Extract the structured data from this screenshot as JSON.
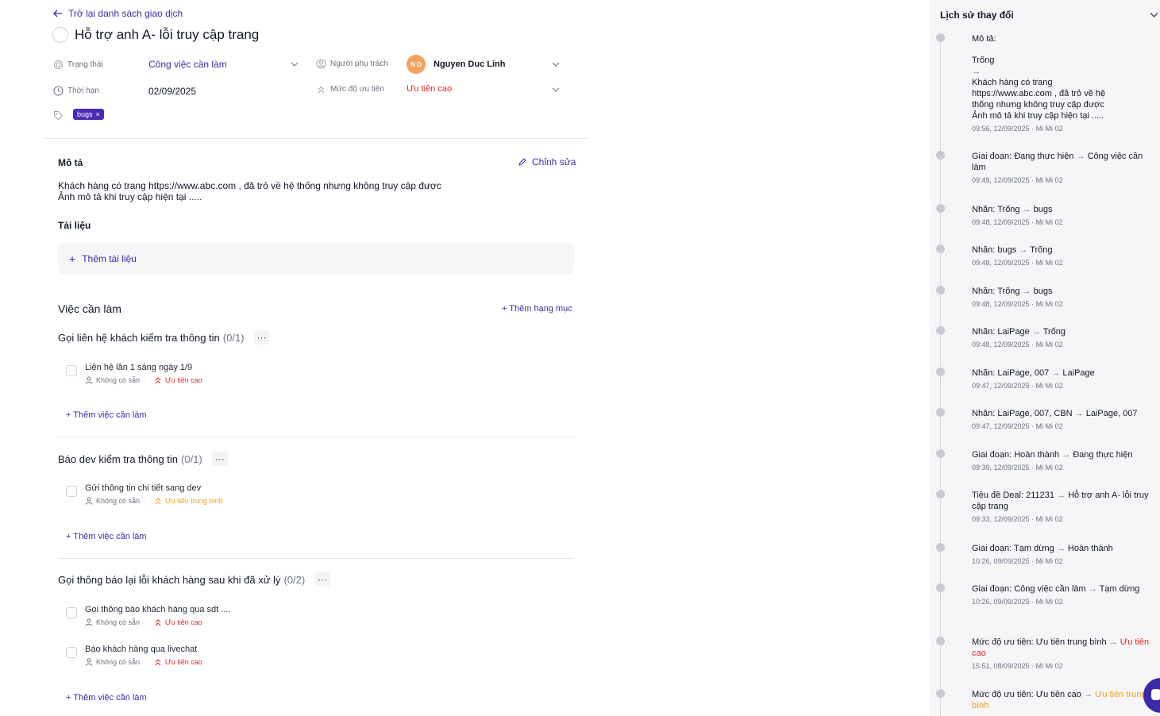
{
  "back": {
    "label": "Trở lại danh sách giao dịch"
  },
  "deal": {
    "title": "Hỗ trợ anh A- lỗi truy cập trang"
  },
  "fields": {
    "status_label": "Trạng thái",
    "status_value": "Công việc cần làm",
    "deadline_label": "Thời hạn",
    "deadline_value": "02/09/2025",
    "assignee_label": "Người phụ trách",
    "assignee_initials": "N D",
    "assignee_name": "Nguyen Duc Linh",
    "priority_label": "Mức độ ưu tiên",
    "priority_value": "Ưu tiên cao"
  },
  "tags": [
    {
      "label": "bugs"
    }
  ],
  "description": {
    "heading": "Mô tả",
    "edit_label": "Chỉnh sửa",
    "line1": "Khách hàng có trang https://www.abc.com , đã trỏ về hệ thống nhưng không truy cập được",
    "line2": "Ảnh mô tả khi truy cập hiện tại ....."
  },
  "documents": {
    "heading": "Tài liệu",
    "add_label": "Thêm tài liệu"
  },
  "todo": {
    "heading": "Việc cần làm",
    "add_category": "+ Thêm hạng mục",
    "add_task_label": "+ Thêm việc cần làm",
    "groups": [
      {
        "title": "Gọi liên hệ khách kiểm tra thông tin",
        "count": "(0/1)",
        "tasks": [
          {
            "name": "Liên hệ lần 1 sáng ngày 1/9",
            "assignee": "Không có sẵn",
            "priority": "Ưu tiên cao"
          }
        ]
      },
      {
        "title": "Báo dev kiểm tra thông tin",
        "count": "(0/1)",
        "tasks": [
          {
            "name": "Gửi thông tin chi tiết sang dev",
            "assignee": "Không có sẵn",
            "priority": "Ưu tiên trung bình"
          }
        ]
      },
      {
        "title": "Gọi thông báo lại lỗi khách hàng sau khi đã xử lý",
        "count": "(0/2)",
        "tasks": [
          {
            "name": "Gọi thông báo khách hàng qua sdt ....",
            "assignee": "Không có sẵn",
            "priority": "Ưu tiên cao"
          },
          {
            "name": "Báo khách hàng qua livechat",
            "assignee": "Không có sẵn",
            "priority": "Ưu tiên cao"
          }
        ]
      }
    ]
  },
  "history": {
    "heading": "Lịch sử thay đổi",
    "first": {
      "label": "Mô tả:",
      "from": "Trống",
      "arrow": "→",
      "to_line1": "Khách hàng có trang",
      "to_line2": "https://www.abc.com , đã trỏ về hệ",
      "to_line3": "thống nhưng không truy cập được",
      "to_line4": "Ảnh mô tả khi truy cập hiện tại .....",
      "time": "09:56, 12/09/2025 · Mi Mi 02"
    },
    "items": [
      {
        "label": "Giai đoạn:",
        "from": "Đang thực hiện",
        "to": "Công việc cần làm",
        "time": "09:49, 12/09/2025 · Mi Mi 02"
      },
      {
        "label": "Nhãn:",
        "from": "Trống",
        "to": "bugs",
        "time": "09:48, 12/09/2025 · Mi Mi 02"
      },
      {
        "label": "Nhãn:",
        "from": "bugs",
        "to": "Trống",
        "time": "09:48, 12/09/2025 · Mi Mi 02"
      },
      {
        "label": "Nhãn:",
        "from": "Trống",
        "to": "bugs",
        "time": "09:48, 12/09/2025 · Mi Mi 02"
      },
      {
        "label": "Nhãn:",
        "from": "LaiPage",
        "to": "Trống",
        "time": "09:48, 12/09/2025 · Mi Mi 02"
      },
      {
        "label": "Nhãn:",
        "from": "LaiPage, 007",
        "to": "LaiPage",
        "time": "09:47, 12/09/2025 · Mi Mi 02"
      },
      {
        "label": "Nhãn:",
        "from": "LaiPage, 007, CBN",
        "to": "LaiPage, 007",
        "time": "09:47, 12/09/2025 · Mi Mi 02"
      },
      {
        "label": "Giai đoạn:",
        "from": "Hoàn thành",
        "to": "Đang thực hiện",
        "time": "09:39, 12/09/2025 · Mi Mi 02"
      },
      {
        "label": "Tiêu đề Deal:",
        "from": "211231",
        "to": "Hỗ trợ anh A- lỗi truy cập trang",
        "time": "09:33, 12/09/2025 · Mi Mi 02"
      },
      {
        "label": "Giai đoạn:",
        "from": "Tạm dừng",
        "to": "Hoàn thành",
        "time": "10:26, 09/09/2025 · Mi Mi 02"
      },
      {
        "label": "Giai đoạn:",
        "from": "Công việc cần làm",
        "to": "Tạm dừng",
        "time": "10:26, 09/09/2025 · Mi Mi 02"
      },
      {
        "label": "Mức độ ưu tiên:",
        "from": "Ưu tiên trung bình",
        "to": "Ưu tiên cao",
        "to_color": "#dc2626",
        "time": "15:51, 08/09/2025 · Mi Mi 02"
      },
      {
        "label": "Mức độ ưu tiên:",
        "from": "Ưu tiên cao",
        "to": "Ưu tiên trung bình",
        "to_color": "#f59e0b",
        "time": ""
      }
    ]
  },
  "colors": {
    "accent": "#3b2aa8",
    "tag_bg": "#4b2bb5",
    "priority_high": "#dc2626",
    "priority_medium": "#f59e0b",
    "avatar": "#f4a261"
  }
}
